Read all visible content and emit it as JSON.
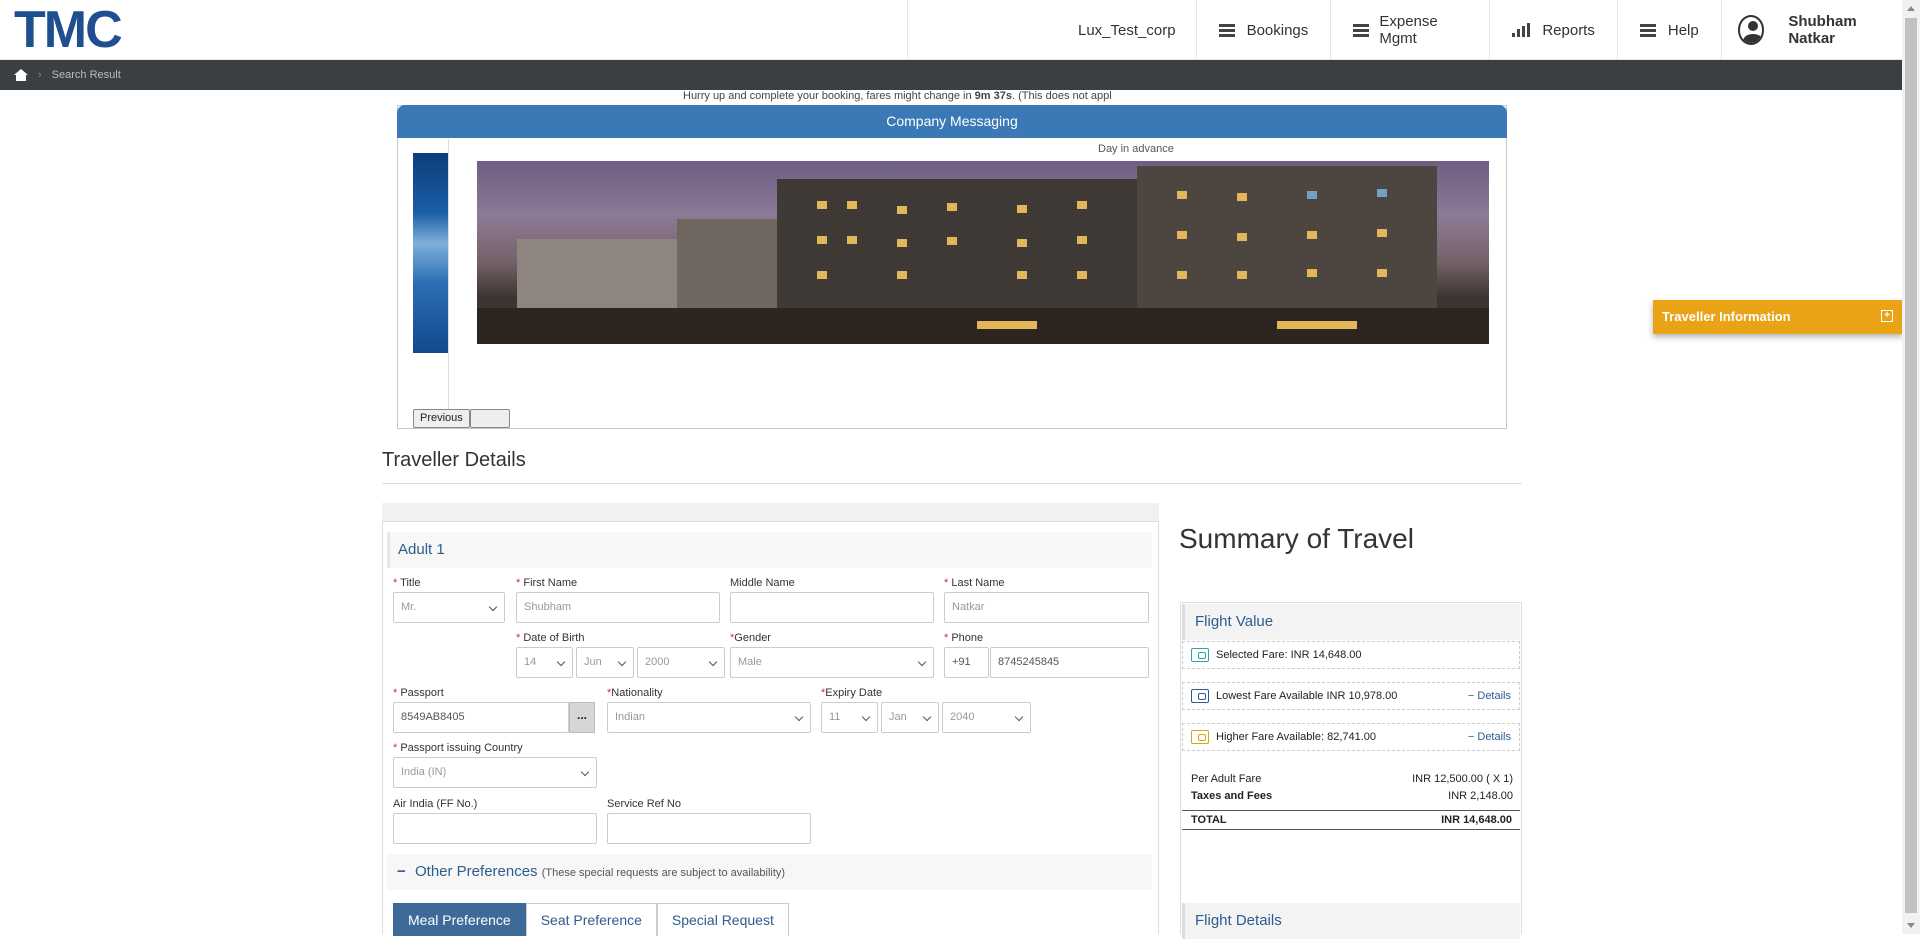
{
  "header": {
    "logo": "TMC",
    "corp": "Lux_Test_corp",
    "nav": [
      {
        "label": "Bookings",
        "icon": "hamburger-icon"
      },
      {
        "label": "Expense Mgmt",
        "icon": "hamburger-icon"
      },
      {
        "label": "Reports",
        "icon": "bar-chart-icon"
      },
      {
        "label": "Help",
        "icon": "hamburger-icon"
      }
    ],
    "user": "Shubham Natkar"
  },
  "breadcrumb": {
    "current": "Search Result"
  },
  "timer": {
    "prefix": "Hurry up and complete your booking, fares might change in ",
    "time": "9m 37s",
    "suffix": ". (This does not appl"
  },
  "company_messaging": {
    "title": "Company Messaging",
    "caption": "Day in advance",
    "previous_label": "Previous",
    "next_label": ""
  },
  "traveller_details": {
    "title": "Traveller Details",
    "adult_label": "Adult 1",
    "fields": {
      "title_label": "Title",
      "title_value": "Mr.",
      "first_name_label": "First Name",
      "first_name_value": "Shubham",
      "middle_name_label": "Middle Name",
      "middle_name_value": "",
      "last_name_label": "Last Name",
      "last_name_value": "Natkar",
      "dob_label": "Date of Birth",
      "dob_day": "14",
      "dob_month": "Jun",
      "dob_year": "2000",
      "gender_label": "Gender",
      "gender_value": "Male",
      "phone_label": "Phone",
      "phone_code": "+91",
      "phone_value": "8745245845",
      "passport_label": "Passport",
      "passport_value": "8549AB8405",
      "passport_more": "...",
      "nationality_label": "Nationality",
      "nationality_value": "Indian",
      "expiry_label": "Expiry Date",
      "expiry_day": "11",
      "expiry_month": "Jan",
      "expiry_year": "2040",
      "issuing_country_label": "Passport issuing Country",
      "issuing_country_value": "India (IN)",
      "ff_label": "Air India (FF No.)",
      "ff_value": "",
      "service_ref_label": "Service Ref No",
      "service_ref_value": ""
    },
    "other_preferences": {
      "label": "Other Preferences",
      "note": "(These special requests are subject to availability)",
      "toggle": "−"
    },
    "tabs": [
      "Meal Preference",
      "Seat Preference",
      "Special Request"
    ]
  },
  "summary": {
    "title": "Summary of Travel",
    "flight_value_label": "Flight Value",
    "selected_fare": "Selected Fare: INR 14,648.00",
    "lowest_fare": "Lowest Fare Available INR 10,978.00",
    "higher_fare": "Higher Fare Available: 82,741.00",
    "details_label": "− Details",
    "per_adult_label": "Per Adult Fare",
    "per_adult_value": "INR 12,500.00 ( X 1)",
    "taxes_label": "Taxes and Fees",
    "taxes_value": "INR 2,148.00",
    "total_label": "TOTAL",
    "total_value": "INR 14,648.00",
    "flight_details_label": "Flight Details"
  },
  "traveller_info": {
    "label": "Traveller Information",
    "toggle": "+"
  },
  "colors": {
    "brand": "#1f4f8f",
    "header_blue": "#3a79b6",
    "accent_orange": "#e8a317",
    "tab_active": "#3e6a99"
  }
}
